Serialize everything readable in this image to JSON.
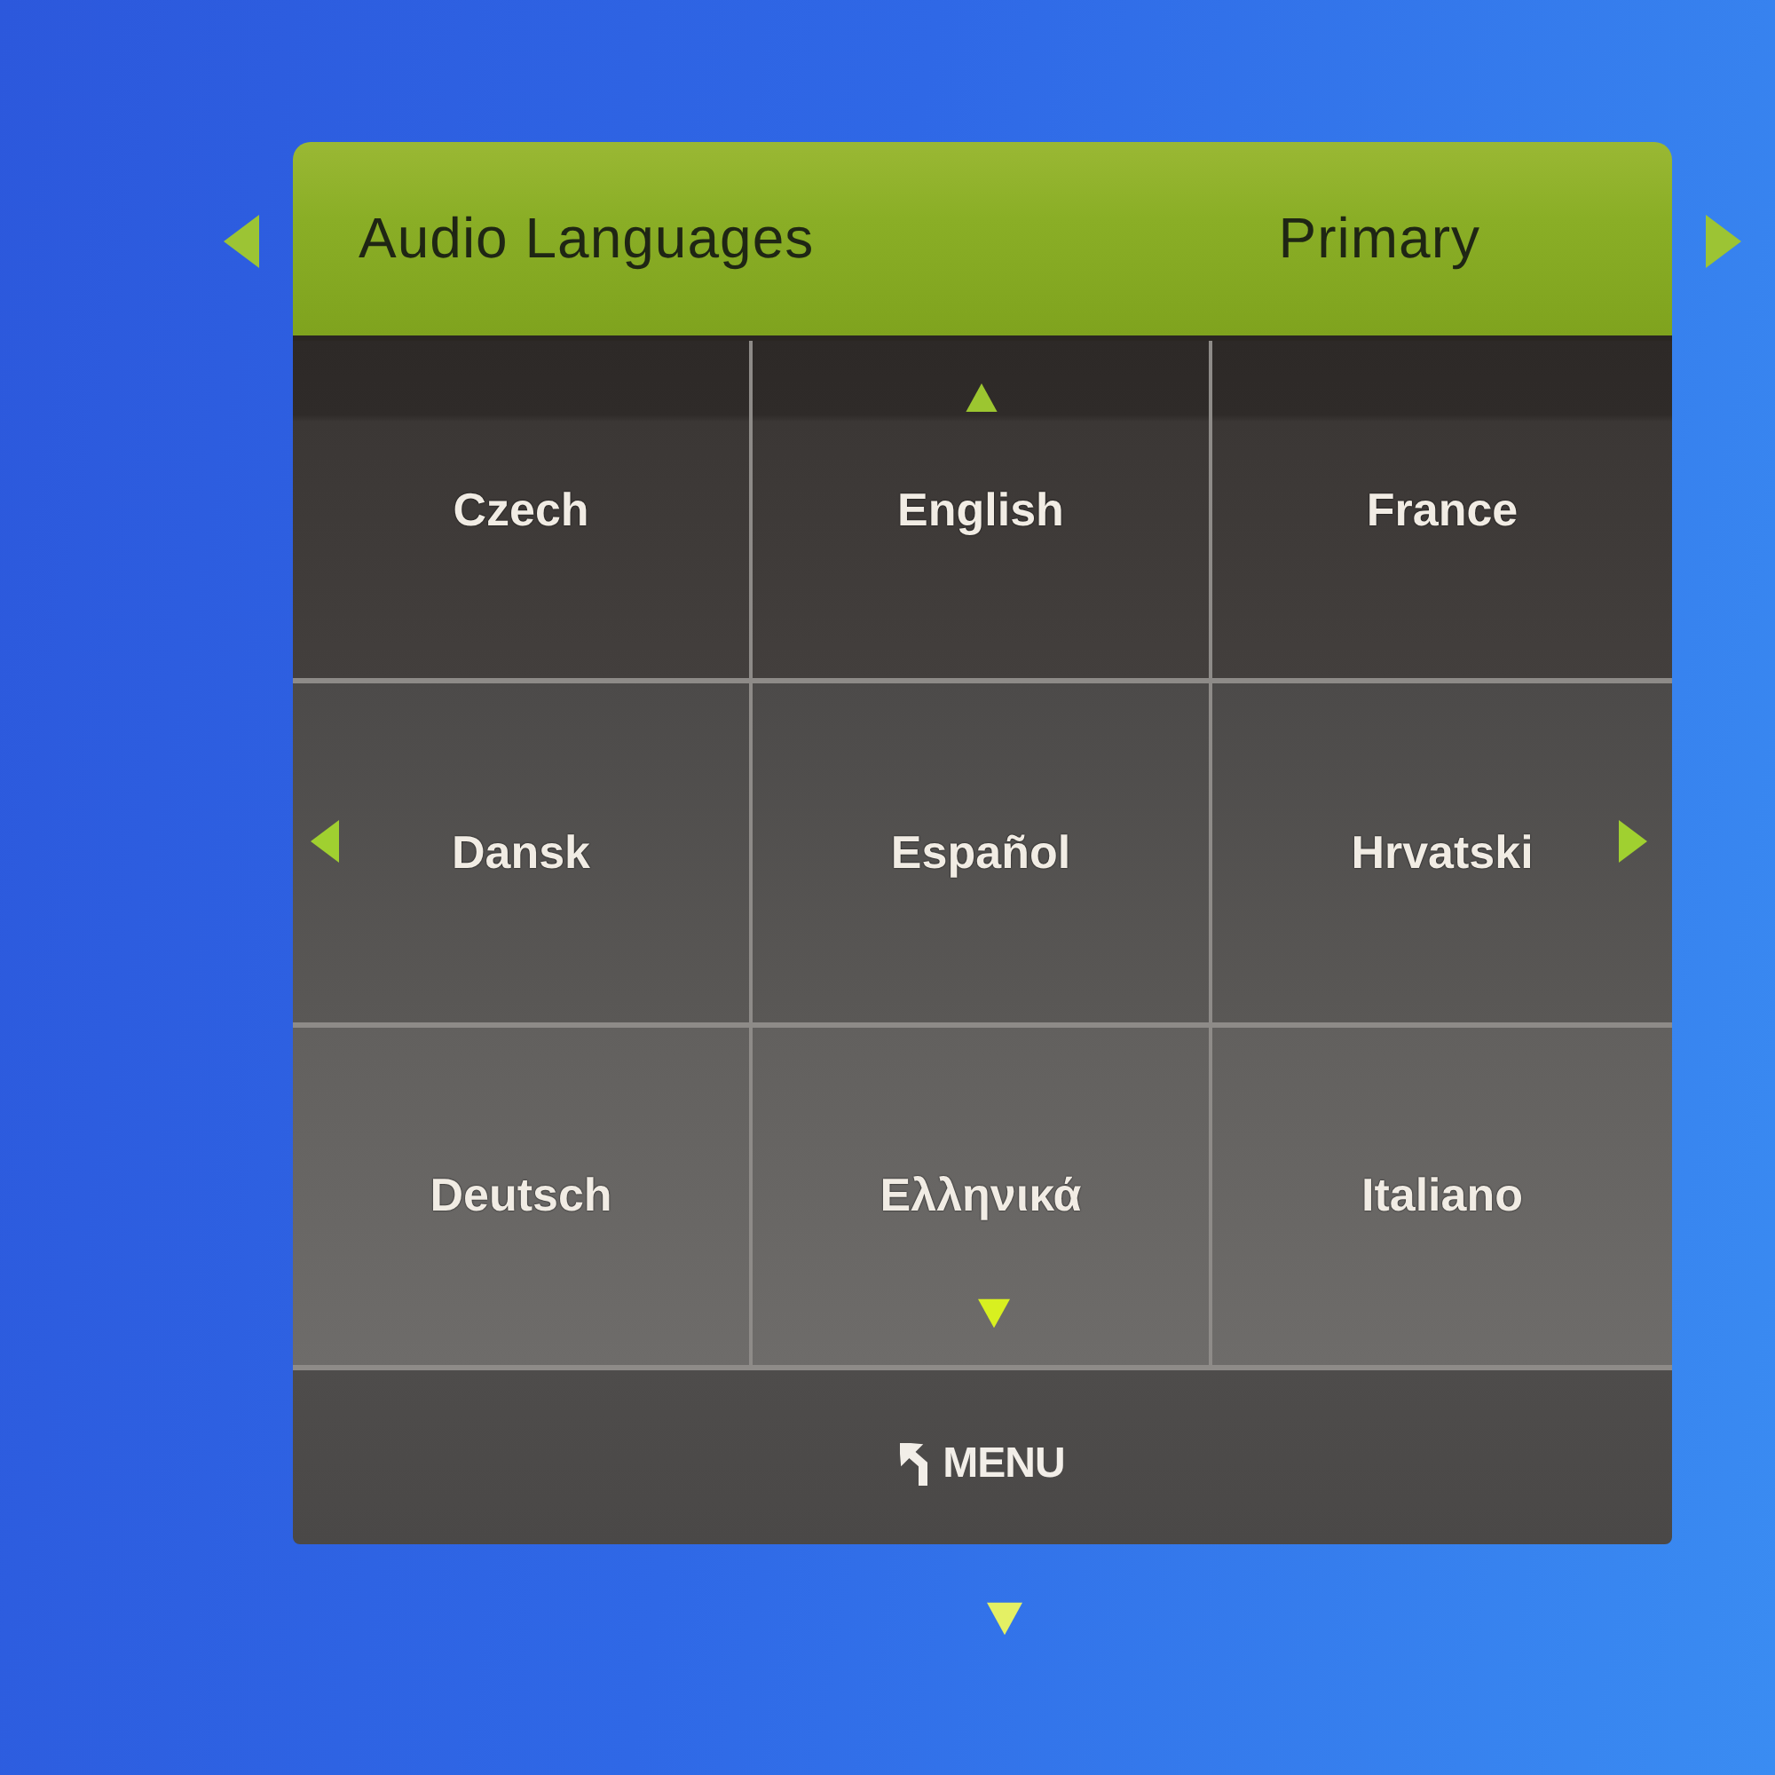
{
  "header": {
    "title": "Audio Languages",
    "value": "Primary"
  },
  "languages": [
    {
      "label": "Czech"
    },
    {
      "label": "English"
    },
    {
      "label": "France"
    },
    {
      "label": "Dansk"
    },
    {
      "label": "Español"
    },
    {
      "label": "Hrvatski"
    },
    {
      "label": "Deutsch"
    },
    {
      "label": "Ελληνικά"
    },
    {
      "label": "Italiano"
    }
  ],
  "footer": {
    "label": "MENU"
  }
}
